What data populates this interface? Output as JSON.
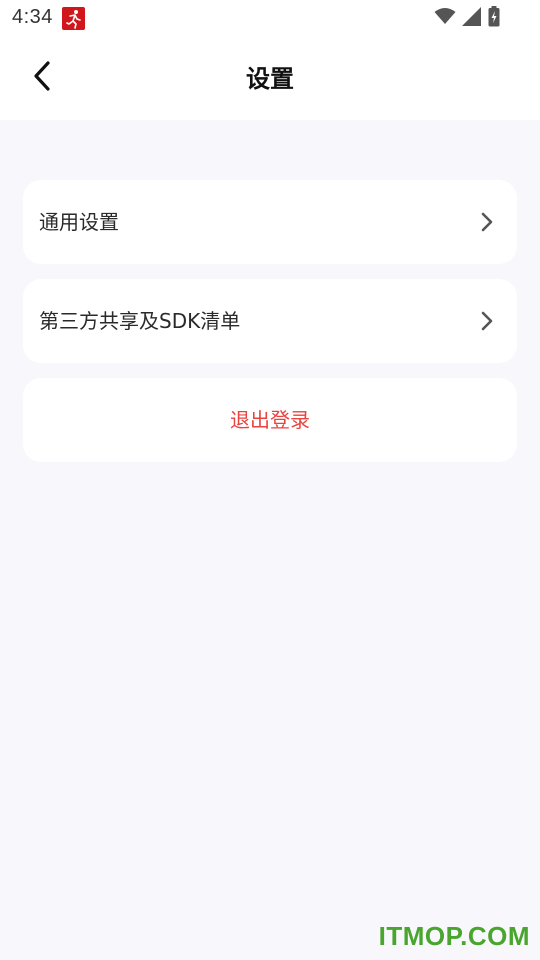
{
  "status_bar": {
    "time": "4:34",
    "notification_icon": "running-person-icon",
    "icons": [
      "wifi-icon",
      "signal-icon",
      "battery-charging-icon"
    ]
  },
  "header": {
    "title": "设置",
    "back_icon": "back-arrow-icon"
  },
  "menu": {
    "items": [
      {
        "label": "通用设置",
        "icon": "chevron-right-icon"
      },
      {
        "label": "第三方共享及SDK清单",
        "icon": "chevron-right-icon"
      }
    ],
    "logout_label": "退出登录"
  },
  "colors": {
    "background": "#f7f7fc",
    "card": "#ffffff",
    "logout_text": "#e8433f",
    "notification_badge": "#d0161b",
    "watermark": "#4aa52e"
  },
  "watermark": "ITMOP.COM"
}
